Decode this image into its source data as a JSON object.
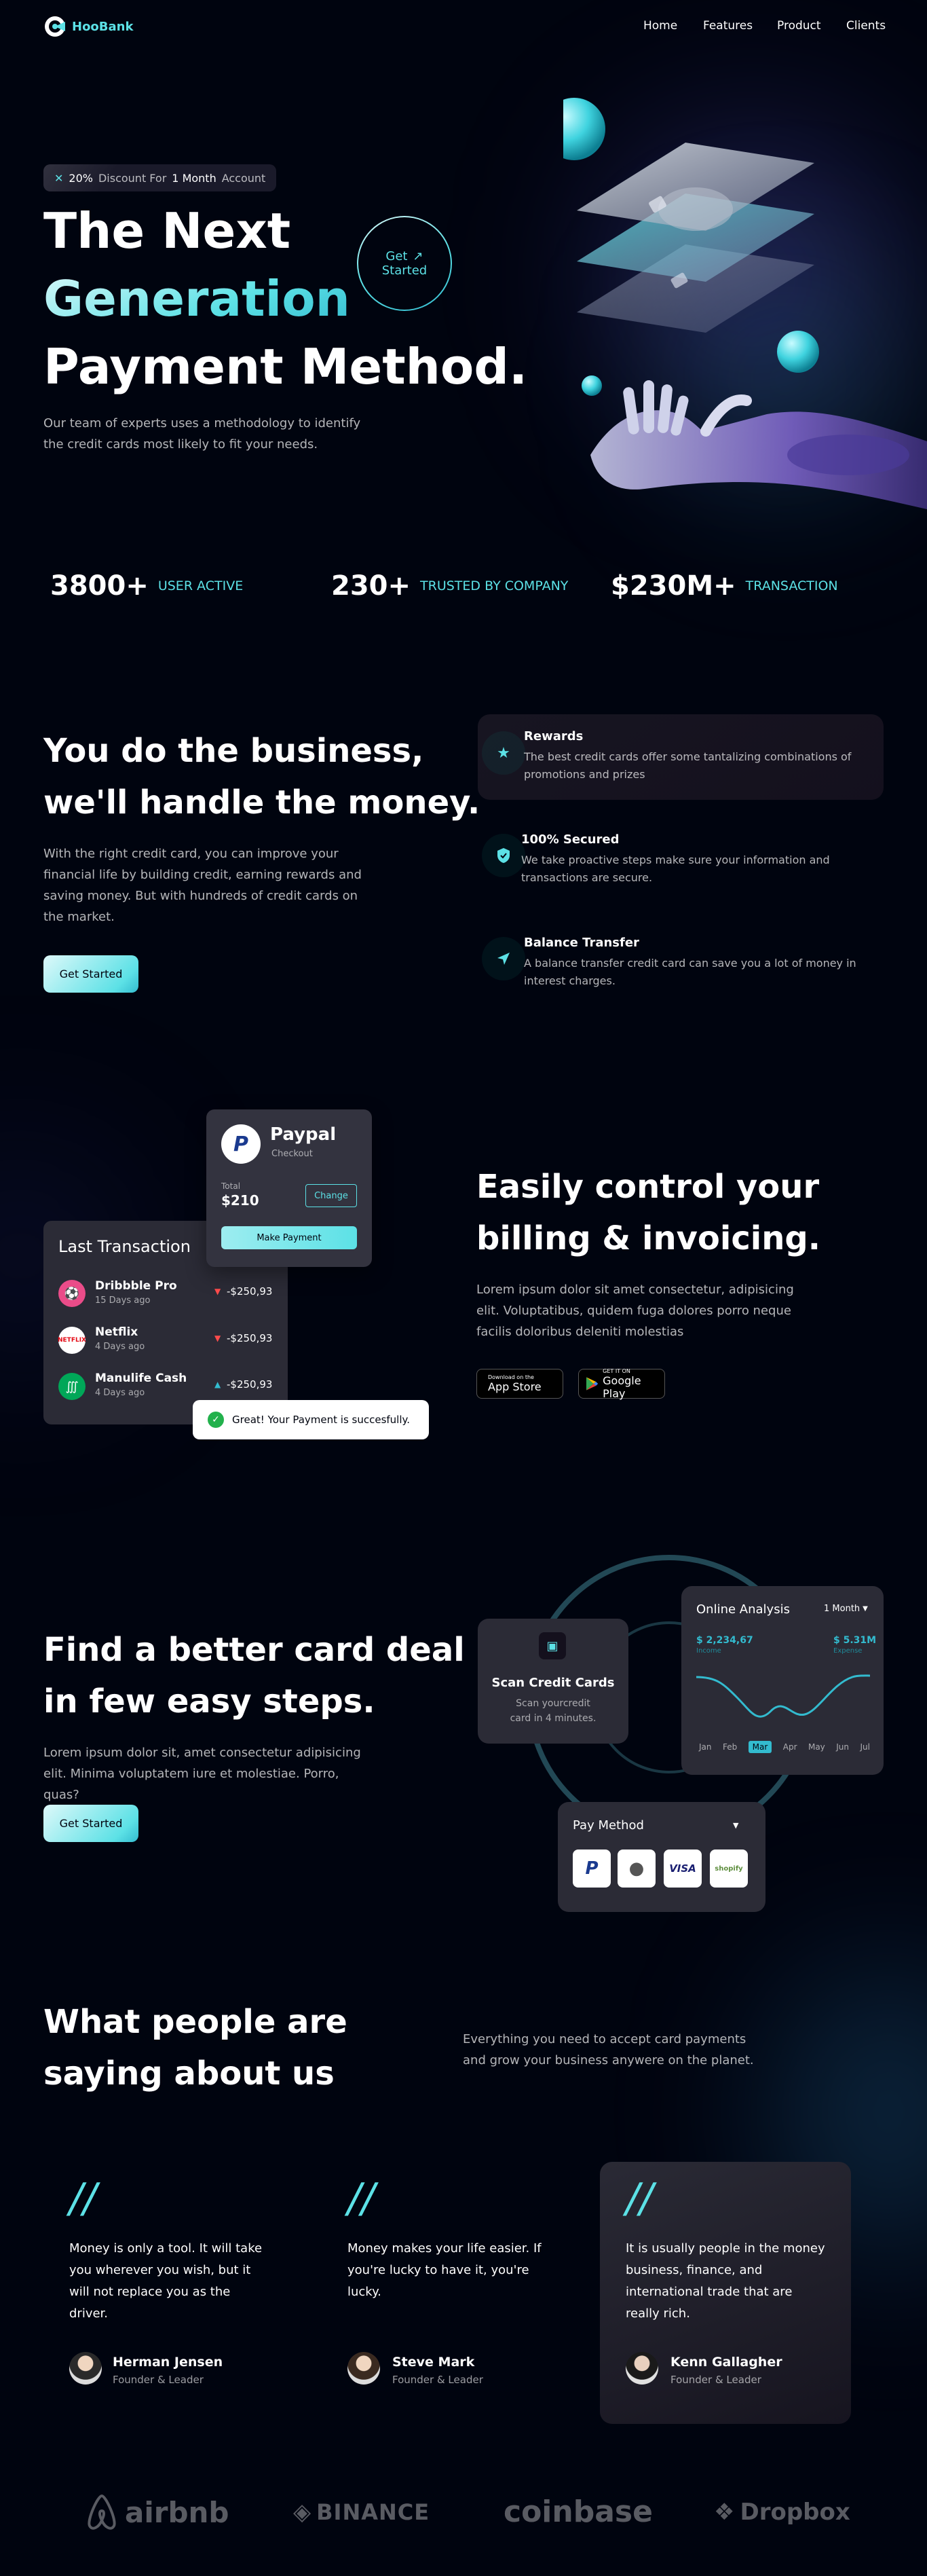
{
  "nav": {
    "brand": "HooBank",
    "links": [
      "Home",
      "Features",
      "Product",
      "Clients"
    ]
  },
  "hero": {
    "badge_percent": "20%",
    "badge_discount": "Discount For",
    "badge_month": "1 Month",
    "badge_account": "Account",
    "title_line1": "The Next",
    "title_line2": "Generation",
    "title_line3": "Payment Method.",
    "description": "Our team of experts uses a methodology to identify the credit cards most likely to fit your needs.",
    "get_started_line1": "Get",
    "get_started_line2": "Started"
  },
  "stats": [
    {
      "value": "3800+",
      "label": "USER ACTIVE"
    },
    {
      "value": "230+",
      "label": "TRUSTED BY COMPANY"
    },
    {
      "value": "$230M+",
      "label": "TRANSACTION"
    }
  ],
  "business": {
    "title_line1": "You do the business,",
    "title_line2": "we'll handle the money.",
    "description": "With the right credit card, you can improve your financial life by building credit, earning rewards and saving money. But with hundreds of credit cards on the market.",
    "button": "Get Started",
    "features": [
      {
        "title": "Rewards",
        "text": "The best credit cards offer some tantalizing combinations of promotions and prizes",
        "icon": "star-icon"
      },
      {
        "title": "100% Secured",
        "text": "We take proactive steps make sure your information and transactions are secure.",
        "icon": "shield-icon"
      },
      {
        "title": "Balance Transfer",
        "text": "A balance transfer credit card can save you a lot of money in interest charges.",
        "icon": "send-icon"
      }
    ]
  },
  "billing": {
    "title_line1": "Easily control your",
    "title_line2": "billing & invoicing.",
    "description": "Lorem ipsum dolor sit amet consectetur, adipisicing elit. Voluptatibus, quidem fuga dolores porro neque facilis doloribus deleniti molestias",
    "app_store_small": "Download on the",
    "app_store_big": "App Store",
    "play_store_small": "GET IT ON",
    "play_store_big": "Google Play",
    "paypal": {
      "name": "Paypal",
      "sub": "Checkout",
      "total_label": "Total",
      "total_value": "$210",
      "change": "Change",
      "make_payment": "Make Payment"
    },
    "last_transaction": {
      "title": "Last Transaction",
      "items": [
        {
          "name": "Dribbble Pro",
          "date": "15 Days ago",
          "amount": "-$250,93",
          "dir": "down"
        },
        {
          "name": "Netflix",
          "date": "4 Days ago",
          "amount": "-$250,93",
          "dir": "down"
        },
        {
          "name": "Manulife Cash",
          "date": "4 Days ago",
          "amount": "-$250,93",
          "dir": "up"
        }
      ]
    },
    "toast": "Great! Your Payment is succesfully."
  },
  "carddeal": {
    "title_line1": "Find a better card deal",
    "title_line2": "in few easy steps.",
    "description": "Lorem ipsum dolor sit, amet consectetur adipisicing elit. Minima voluptatem iure et molestiae. Porro, quas?",
    "button": "Get Started",
    "scan": {
      "title": "Scan Credit Cards",
      "text": "Scan yourcredit card in 4 minutes."
    },
    "analysis": {
      "title": "Online Analysis",
      "period": "1 Month",
      "income_value": "$ 2,234,67",
      "income_label": "Income",
      "expense_value": "$ 5.31M",
      "expense_label": "Expense",
      "months": [
        "Jan",
        "Feb",
        "Mar",
        "Apr",
        "May",
        "Jun",
        "Jul"
      ],
      "active_month": "Mar"
    },
    "pay_method": {
      "title": "Pay Method",
      "options": [
        "paypal-icon",
        "apple-icon",
        "VISA",
        "shopify"
      ]
    }
  },
  "testimonials": {
    "title_line1": "What people are",
    "title_line2": "saying about us",
    "description": "Everything you need to accept card payments and grow your business anywere on the planet.",
    "items": [
      {
        "quote": "Money is only a tool. It will take you wherever you wish, but it will not replace you as the driver.",
        "name": "Herman Jensen",
        "role": "Founder & Leader"
      },
      {
        "quote": "Money makes your life easier. If you're lucky to have it, you're lucky.",
        "name": "Steve Mark",
        "role": "Founder & Leader"
      },
      {
        "quote": "It is usually people in the money business, finance, and international trade that are really rich.",
        "name": "Kenn Gallagher",
        "role": "Founder & Leader"
      }
    ]
  },
  "clients": [
    "airbnb",
    "BINANCE",
    "coinbase",
    "Dropbox"
  ],
  "colors": {
    "accent": "#5ce1e6",
    "background": "#00040f",
    "card": "#14101d"
  }
}
